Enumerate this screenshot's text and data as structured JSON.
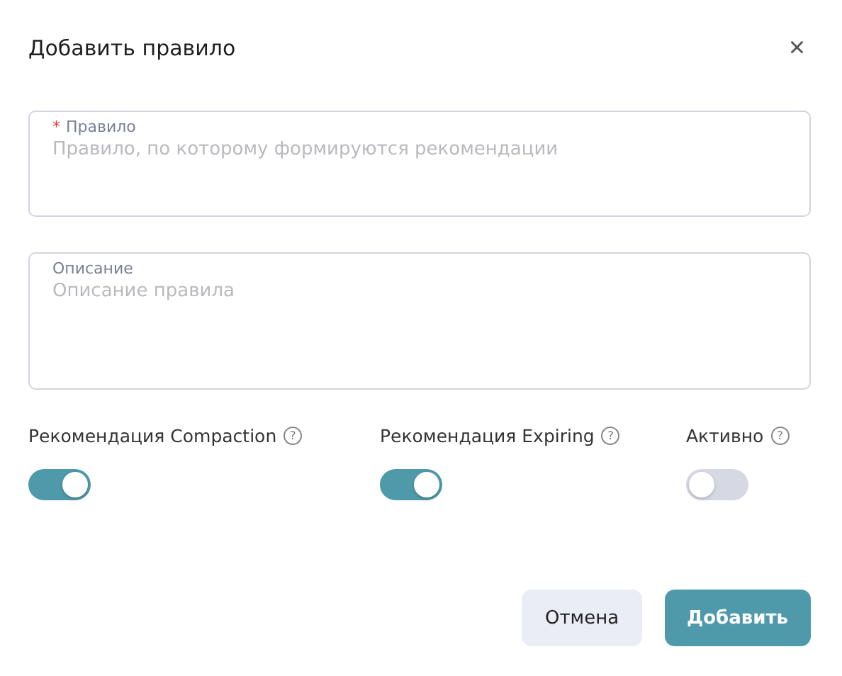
{
  "dialog": {
    "title": "Добавить правило",
    "close": "×"
  },
  "fields": [
    {
      "label": "Правило",
      "required_mark": "*",
      "placeholder": "Правило, по которому формируются рекомендации",
      "kind": "tall"
    },
    {
      "label": "Описание",
      "placeholder": "Описание правила",
      "kind": "taller"
    }
  ],
  "switches": [
    {
      "label": "Рекомендация Compaction",
      "help": "?",
      "on": true
    },
    {
      "label": "Рекомендация Expiring",
      "help": "?",
      "on": true
    },
    {
      "label": "Активно",
      "help": "?",
      "on": false
    }
  ],
  "buttons": [
    {
      "label": "Отмена",
      "kind": "secondary"
    },
    {
      "label": "Добавить",
      "kind": "primary"
    }
  ]
}
